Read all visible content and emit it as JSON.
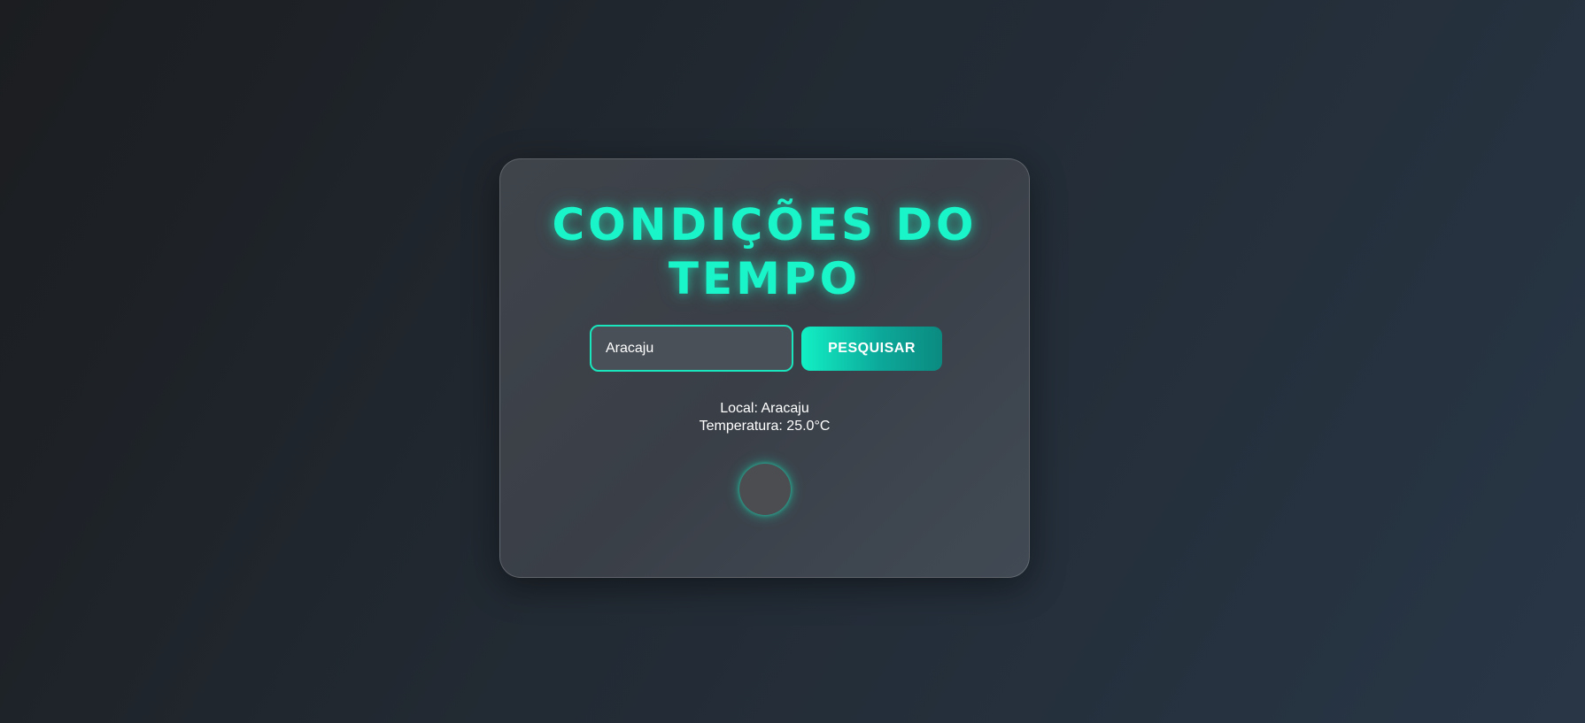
{
  "header": {
    "title": "CONDIÇÕES DO TEMPO"
  },
  "search": {
    "value": "Aracaju",
    "button_label": "PESQUISAR"
  },
  "result": {
    "location": "Local: Aracaju",
    "temperature": "Temperatura: 25.0°C"
  },
  "icons": {
    "weather": "weather-icon"
  },
  "colors": {
    "accent": "#19f5c8",
    "card": "#3f444b",
    "background_start": "#1b1d20",
    "background_end": "#283646"
  }
}
